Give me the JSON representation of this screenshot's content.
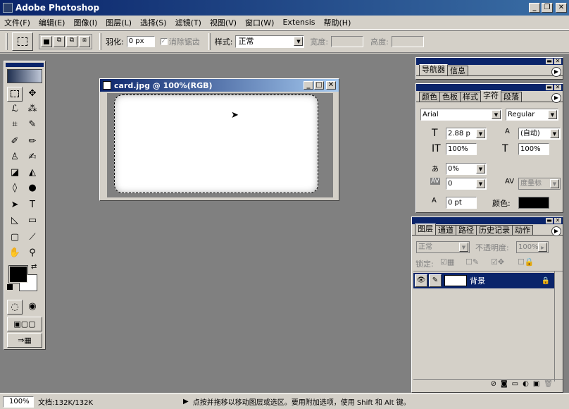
{
  "app": {
    "title": "Adobe Photoshop"
  },
  "menu": [
    "文件(F)",
    "编辑(E)",
    "图像(I)",
    "图层(L)",
    "选择(S)",
    "滤镜(T)",
    "视图(V)",
    "窗口(W)",
    "Extensis",
    "帮助(H)"
  ],
  "options": {
    "feather_label": "羽化:",
    "feather_value": "0 px",
    "antialias_label": "消除锯齿",
    "style_label": "样式:",
    "style_value": "正常",
    "width_label": "宽度:",
    "height_label": "高度:"
  },
  "document": {
    "title": "card.jpg @ 100%(RGB)"
  },
  "navigator": {
    "tabs": [
      "导航器",
      "信息"
    ]
  },
  "character": {
    "tabs": [
      "颜色",
      "色板",
      "样式",
      "字符",
      "段落"
    ],
    "font": "Arial",
    "style": "Regular",
    "size": "2.88 p",
    "leading": "(自动)",
    "vscale": "100%",
    "hscale": "100%",
    "tracking": "0%",
    "kerning": "0",
    "kerning_method": "度量标",
    "baseline": "0 pt",
    "color_label": "颜色:"
  },
  "layers": {
    "tabs": [
      "图层",
      "通道",
      "路径",
      "历史记录",
      "动作"
    ],
    "blend_mode": "正常",
    "opacity_label": "不透明度:",
    "opacity_value": "100%",
    "lock_label": "锁定:",
    "layer_name": "背景"
  },
  "status": {
    "zoom": "100%",
    "doc_info": "文档:132K/132K",
    "hint": "点按并拖移以移动图层或选区。要用附加选项，使用 Shift 和 Alt 键。"
  }
}
